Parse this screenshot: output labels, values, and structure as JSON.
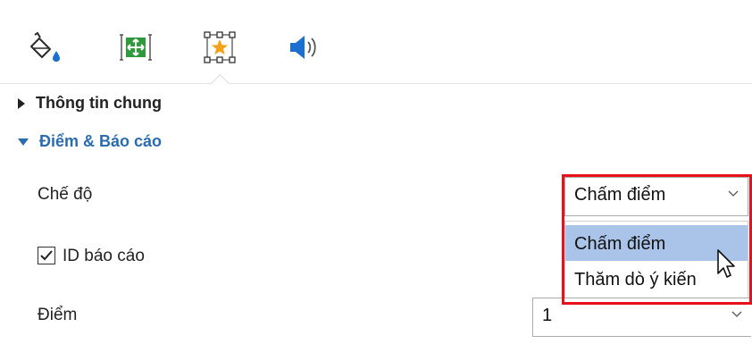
{
  "tabs": [
    {
      "name": "fill",
      "icon": "paint-bucket-icon"
    },
    {
      "name": "layout",
      "icon": "move-frame-icon"
    },
    {
      "name": "effects",
      "icon": "star-frame-icon",
      "selected": true
    },
    {
      "name": "audio",
      "icon": "speaker-icon"
    }
  ],
  "sections": {
    "general": {
      "label": "Thông tin chung",
      "expanded": false
    },
    "score": {
      "label": "Điểm & Báo cáo",
      "expanded": true
    }
  },
  "fields": {
    "mode": {
      "label": "Chế độ",
      "value": "Chấm điểm",
      "options": [
        "Chấm điểm",
        "Thăm dò ý kiến"
      ],
      "hovered_option": "Chấm điểm"
    },
    "report_id": {
      "label": "ID báo cáo",
      "checked": true
    },
    "score": {
      "label": "Điểm",
      "value": "1"
    }
  },
  "colors": {
    "accent": "#2b6cb0",
    "highlight_border": "#e8101b",
    "option_hover": "#a9c4e8"
  }
}
